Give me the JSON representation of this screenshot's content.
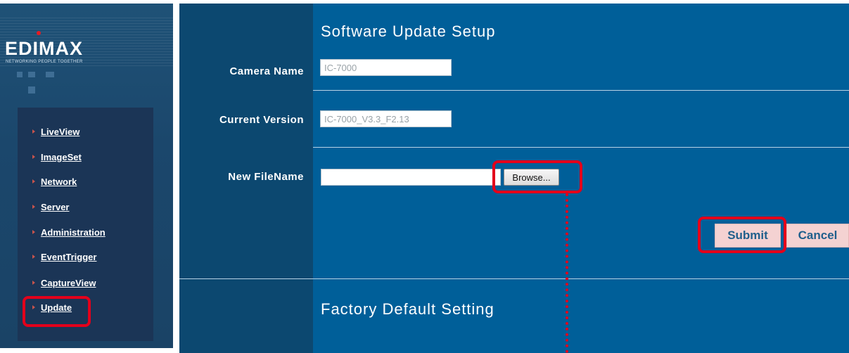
{
  "logo": {
    "text": "EDIMAX",
    "tagline": "NETWORKING PEOPLE TOGETHER"
  },
  "sidebar": {
    "items": [
      {
        "label": "LiveView"
      },
      {
        "label": "ImageSet"
      },
      {
        "label": "Network"
      },
      {
        "label": "Server"
      },
      {
        "label": "Administration"
      },
      {
        "label": "EventTrigger"
      },
      {
        "label": "CaptureView"
      },
      {
        "label": "Update"
      }
    ],
    "highlighted": "Update"
  },
  "software_update": {
    "title": "Software Update Setup",
    "camera_name": {
      "label": "Camera Name",
      "value": "IC-7000"
    },
    "current_version": {
      "label": "Current Version",
      "value": "IC-7000_V3.3_F2.13"
    },
    "new_filename": {
      "label": "New FileName",
      "value": "",
      "browse_label": "Browse..."
    },
    "submit_label": "Submit",
    "cancel_label": "Cancel"
  },
  "factory_default": {
    "title": "Factory Default Setting"
  },
  "colors": {
    "main_bg": "#005f99",
    "label_col_bg": "#0c4870",
    "sidebar_bg": "#1b476c",
    "highlight": "#e3001b",
    "button_bg": "#f4d2d2",
    "button_text": "#1f5f8c"
  }
}
